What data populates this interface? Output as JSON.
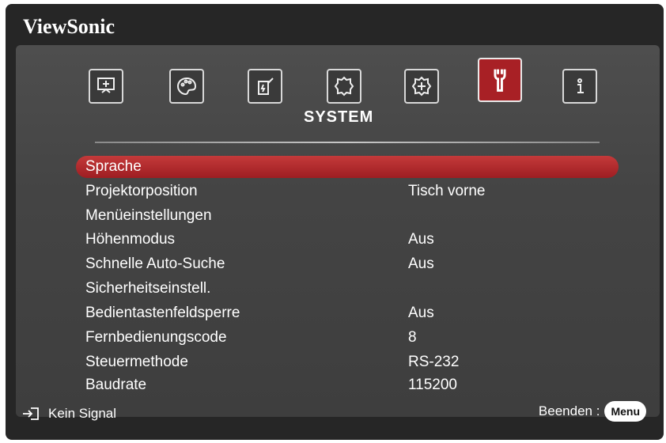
{
  "brand": "ViewSonic",
  "tabs": [
    {
      "icon": "display-icon",
      "active": false
    },
    {
      "icon": "palette-icon",
      "active": false
    },
    {
      "icon": "power-plug-icon",
      "active": false
    },
    {
      "icon": "gear-icon",
      "active": false
    },
    {
      "icon": "advanced-gear-icon",
      "active": false
    },
    {
      "icon": "wrench-icon",
      "active": true
    },
    {
      "icon": "info-icon",
      "active": false
    }
  ],
  "section_title": "SYSTEM",
  "menu": [
    {
      "label": "Sprache",
      "value": "",
      "selected": true
    },
    {
      "label": "Projektorposition",
      "value": "Tisch vorne"
    },
    {
      "label": "Menüeinstellungen",
      "value": ""
    },
    {
      "label": "Höhenmodus",
      "value": "Aus"
    },
    {
      "label": "Schnelle Auto-Suche",
      "value": "Aus"
    },
    {
      "label": "Sicherheitseinstell.",
      "value": ""
    },
    {
      "label": "Bedientastenfeldsperre",
      "value": "Aus"
    },
    {
      "label": "Fernbedienungscode",
      "value": "8"
    },
    {
      "label": "Steuermethode",
      "value": "RS-232"
    },
    {
      "label": "Baudrate",
      "value": "115200"
    }
  ],
  "footer": {
    "signal_text": "Kein Signal",
    "exit_text": "Beenden :",
    "menu_button": "Menu"
  },
  "colors": {
    "accent": "#a82025",
    "background": "#262626"
  }
}
